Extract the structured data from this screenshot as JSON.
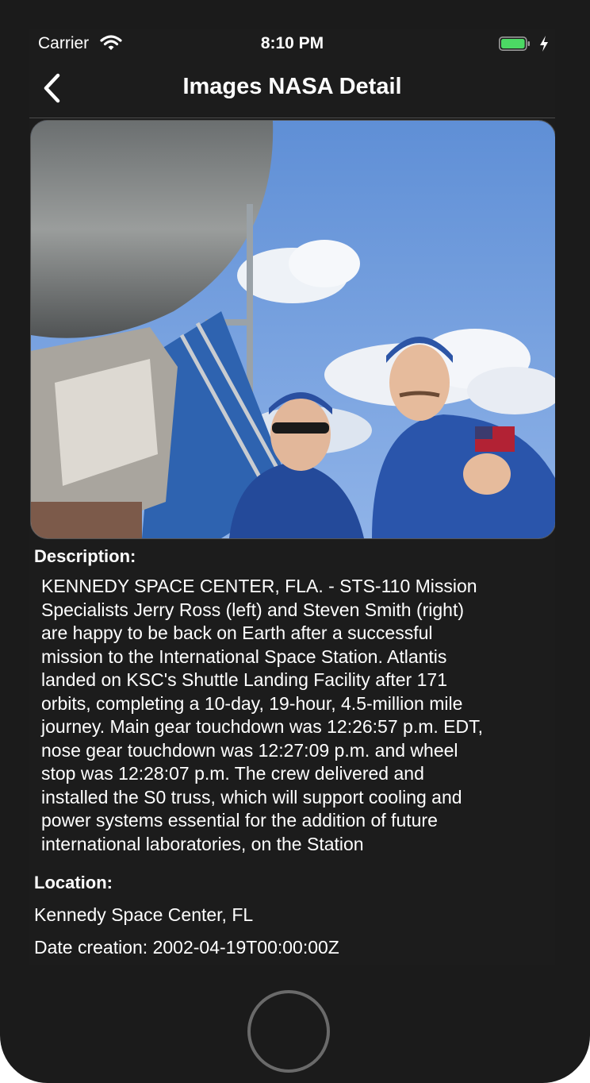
{
  "status_bar": {
    "carrier": "Carrier",
    "time": "8:10 PM",
    "icons": [
      "wifi-icon",
      "battery-icon",
      "charging-bolt-icon"
    ],
    "battery_color": "#4cd964"
  },
  "nav": {
    "title": "Images NASA Detail",
    "back_icon": "chevron-left-icon"
  },
  "detail": {
    "description_label": "Description:",
    "description": "KENNEDY SPACE CENTER, FLA. - STS-110 Mission\nSpecialists Jerry Ross (left) and Steven Smith (right)\nare happy to be back on Earth after a successful\nmission to the International Space Station.  Atlantis\nlanded on KSC's Shuttle Landing Facility after 171\norbits, completing a 10-day, 19-hour, 4.5-million mile\njourney. Main gear touchdown was 12:26:57 p.m. EDT,\nnose gear touchdown was 12:27:09 p.m. and wheel\nstop was 12:28:07 p.m.  The crew delivered and\ninstalled the S0 truss, which will support cooling and\npower systems essential for the addition of future\ninternational laboratories, on the Station",
    "location_label": "Location:",
    "location": "Kennedy Space Center, FL",
    "date_creation": "Date creation: 2002-04-19T00:00:00Z"
  },
  "colors": {
    "background": "#1c1c1c",
    "text": "#ffffff"
  }
}
